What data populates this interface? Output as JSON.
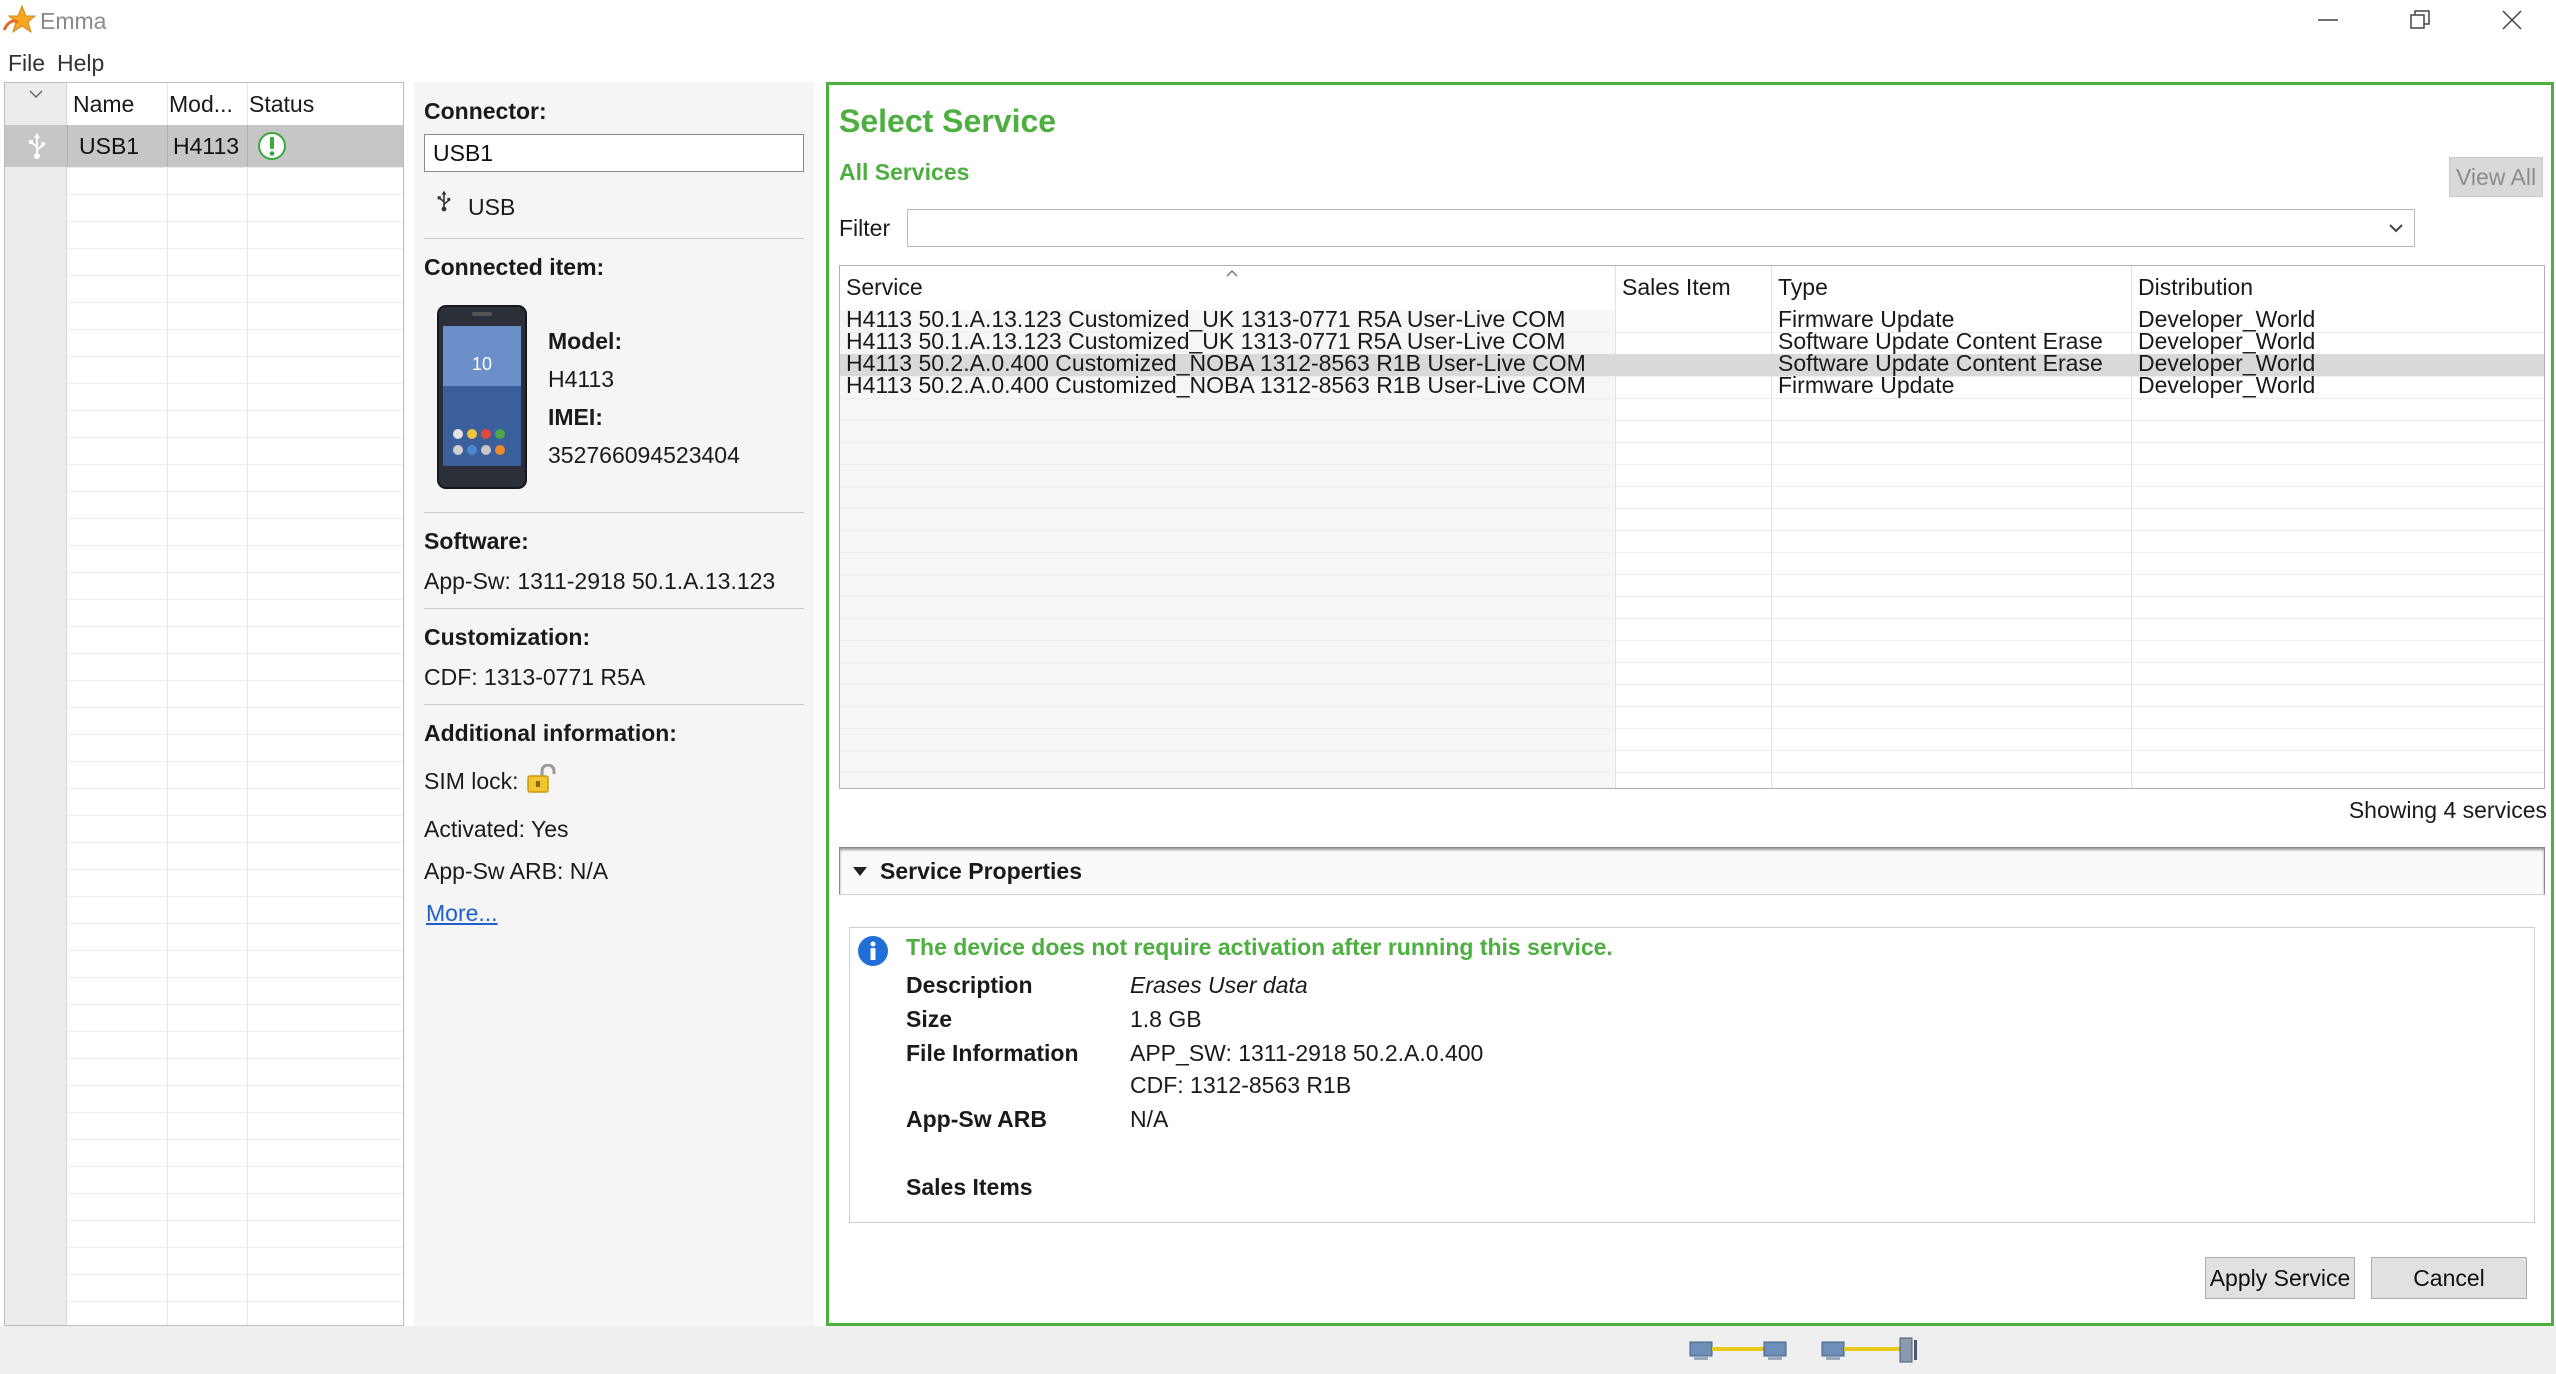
{
  "window": {
    "title": "Emma",
    "icon": "emma-star-icon",
    "controls": [
      "minimize-icon",
      "restore-icon",
      "close-icon"
    ]
  },
  "menu": {
    "file": "File",
    "help": "Help"
  },
  "device_list": {
    "columns": [
      "Name",
      "Mod...",
      "Status"
    ],
    "rows": [
      {
        "icon": "usb-icon",
        "name": "USB1",
        "model": "H4113",
        "status_icon": "attention-icon"
      }
    ]
  },
  "details": {
    "connector_label": "Connector:",
    "connector_value": "USB1",
    "connection_type": "USB",
    "connected_item_label": "Connected item:",
    "model_label": "Model:",
    "model_value": "H4113",
    "imei_label": "IMEI:",
    "imei_value": "352766094523404",
    "software_label": "Software:",
    "software_value": "App-Sw: 1311-2918 50.1.A.13.123",
    "customization_label": "Customization:",
    "customization_value": "CDF: 1313-0771 R5A",
    "additional_label": "Additional information:",
    "sim_lock": "SIM lock:",
    "sim_lock_icon": "unlocked-padlock-icon",
    "activated": "Activated: Yes",
    "app_sw_arb": "App-Sw ARB: N/A",
    "more_link": "More...",
    "phone_screen_time": "10"
  },
  "service": {
    "title": "Select Service",
    "subtitle": "All Services",
    "view_all": "View All",
    "filter_label": "Filter",
    "filter_value": "",
    "table": {
      "columns": [
        "Service",
        "Sales Item",
        "Type",
        "Distribution"
      ],
      "sort_column": "Service",
      "rows": [
        {
          "service": "H4113 50.1.A.13.123 Customized_UK 1313-0771 R5A User-Live COM",
          "sales_item": "",
          "type": "Firmware Update",
          "distribution": "Developer_World",
          "selected": false
        },
        {
          "service": "H4113 50.1.A.13.123 Customized_UK 1313-0771 R5A User-Live COM",
          "sales_item": "",
          "type": "Software Update Content Erase",
          "distribution": "Developer_World",
          "selected": false
        },
        {
          "service": "H4113 50.2.A.0.400 Customized_NOBA 1312-8563 R1B User-Live COM",
          "sales_item": "",
          "type": "Software Update Content Erase",
          "distribution": "Developer_World",
          "selected": true
        },
        {
          "service": "H4113 50.2.A.0.400 Customized_NOBA 1312-8563 R1B User-Live COM",
          "sales_item": "",
          "type": "Firmware Update",
          "distribution": "Developer_World",
          "selected": false
        }
      ]
    },
    "showing": "Showing 4 services",
    "properties": {
      "header": "Service Properties",
      "activation_note": "The device does not require activation after running this service.",
      "description_label": "Description",
      "description_value": "Erases User data",
      "size_label": "Size",
      "size_value": "1.8 GB",
      "file_info_label": "File Information",
      "file_info_line1": "APP_SW: 1311-2918 50.2.A.0.400",
      "file_info_line2": "CDF: 1312-8563 R1B",
      "arb_label": "App-Sw ARB",
      "arb_value": "N/A",
      "sales_items_label": "Sales Items"
    },
    "apply_button": "Apply Service",
    "cancel_button": "Cancel"
  },
  "statusbar": {
    "icons": [
      "network-connection-icon",
      "device-connection-icon"
    ]
  },
  "colors": {
    "accent_green": "#4caf3f",
    "selection_gray": "#d9d9d9",
    "link_blue": "#1e5fcc"
  }
}
